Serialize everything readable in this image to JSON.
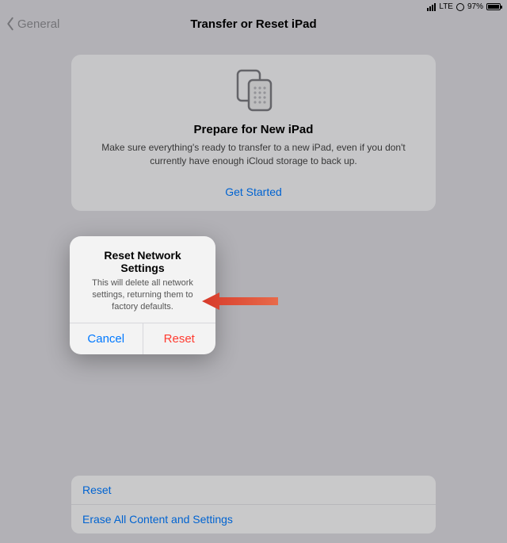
{
  "status": {
    "carrier": "LTE",
    "battery_pct": "97%"
  },
  "nav": {
    "back_label": "General",
    "title": "Transfer or Reset iPad"
  },
  "prepare_card": {
    "title": "Prepare for New iPad",
    "description": "Make sure everything's ready to transfer to a new iPad, even if you don't currently have enough iCloud storage to back up.",
    "action": "Get Started"
  },
  "options": {
    "reset": "Reset",
    "erase": "Erase All Content and Settings"
  },
  "alert": {
    "title": "Reset Network Settings",
    "message": "This will delete all network settings, returning them to factory defaults.",
    "cancel": "Cancel",
    "confirm": "Reset"
  },
  "colors": {
    "link": "#0079ff",
    "destructive": "#ff3b30"
  }
}
